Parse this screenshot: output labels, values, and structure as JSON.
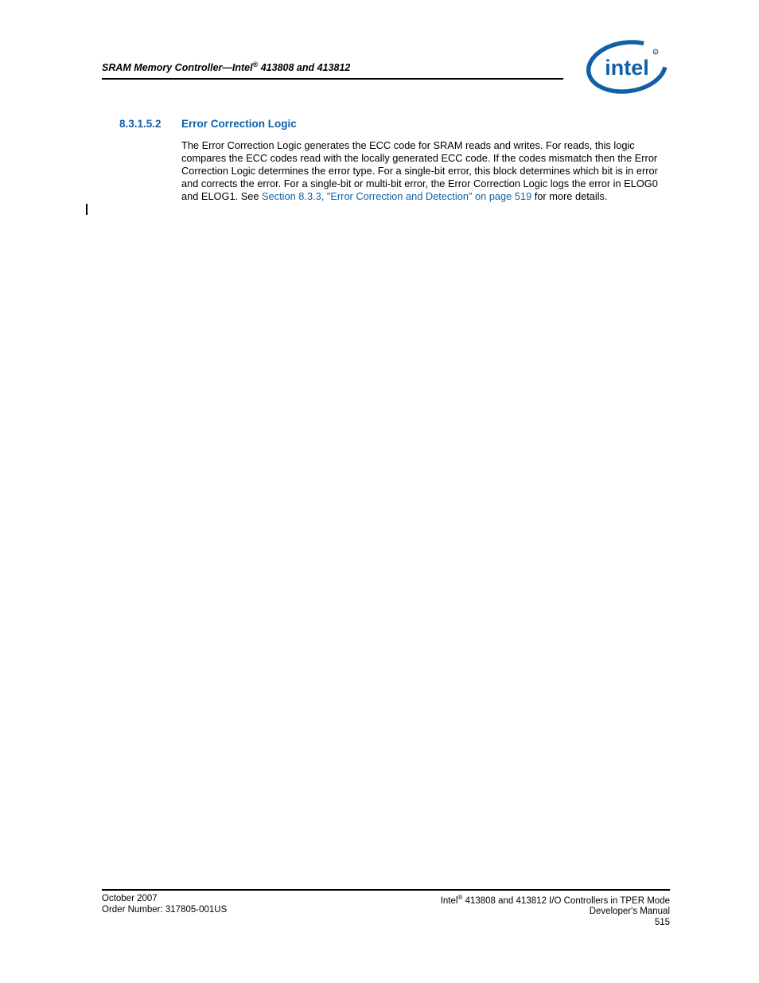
{
  "header": {
    "title_prefix": "SRAM Memory Controller—Intel",
    "title_suffix": " 413808 and 413812",
    "reg_symbol": "®"
  },
  "section": {
    "number": "8.3.1.5.2",
    "title": "Error Correction Logic"
  },
  "body": {
    "part1": "The Error Correction Logic generates the ECC code for SRAM reads and writes. For reads, this logic compares the ECC codes read with the locally generated ECC code. If the codes mismatch then the Error Correction Logic determines the error type. For a single-bit error, this block determines which bit is in error and corrects the error. For a single-bit or multi-bit error, the Error Correction Logic logs the error in ELOG0 and ELOG1. See ",
    "link": "Section 8.3.3, \"Error Correction and Detection\" on page 519",
    "part2": " for more details."
  },
  "footer": {
    "left_line1": "October 2007",
    "left_line2": "Order Number: 317805-001US",
    "right_line1_prefix": "Intel",
    "right_line1_reg": "®",
    "right_line1_suffix": " 413808 and 413812 I/O Controllers in TPER Mode",
    "right_line2": "Developer's Manual",
    "right_line3": "515"
  }
}
